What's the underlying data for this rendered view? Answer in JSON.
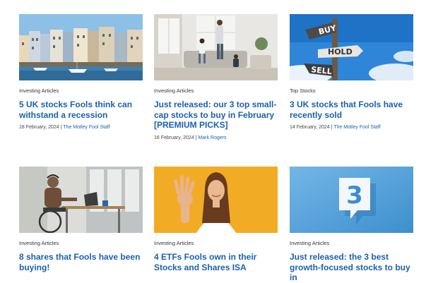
{
  "articles": [
    {
      "category": "Investing Articles",
      "title": "5 UK stocks Fools think can withstand a recession",
      "date": "18 February, 2024",
      "sep": " | ",
      "author": "The Motley Fool Staff",
      "image": "harbour-town"
    },
    {
      "category": "Investing Articles",
      "title": "Just released: our 3 top small-cap stocks to buy in February [PREMIUM PICKS]",
      "date": "16 February, 2024",
      "sep": " | ",
      "author": "Mark Rogers",
      "image": "family-living-room"
    },
    {
      "category": "Top Stocks",
      "title": "3 UK stocks that Fools have recently sold",
      "date": "14 February, 2024",
      "sep": " | ",
      "author": "The Motley Fool Staff",
      "image": "buy-hold-sell-signpost"
    },
    {
      "category": "Investing Articles",
      "title": "8 shares that Fools have been buying!",
      "image": "man-wheelchair-laptop"
    },
    {
      "category": "Investing Articles",
      "title": "4 ETFs Fools own in their Stocks and Shares ISA",
      "image": "woman-four-fingers"
    },
    {
      "category": "Investing Articles",
      "title": "Just released: the 3 best growth-focused stocks to buy in",
      "image": "number-three-speech-bubble"
    }
  ],
  "sign": {
    "buy": "BUY",
    "hold": "HOLD",
    "sell": "SELL"
  },
  "bubble_number": "3",
  "colors": {
    "link": "#1a61ad",
    "category": "#333333"
  }
}
